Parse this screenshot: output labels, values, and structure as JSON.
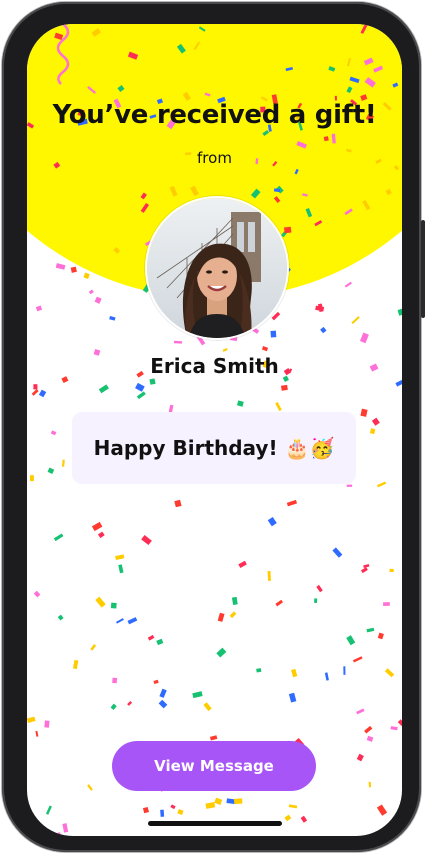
{
  "gift": {
    "title": "You’ve received a gift!",
    "from_label": "from",
    "sender_name": "Erica Smith",
    "message": "Happy Birthday! 🎂🥳",
    "button_label": "View Message"
  },
  "colors": {
    "header_yellow": "#fff700",
    "button_purple": "#a855f7",
    "card_background": "#f6f2ff",
    "confetti": [
      "#ff2d55",
      "#2f6bff",
      "#16c172",
      "#ffcc00",
      "#ff6fd8",
      "#ff3b30"
    ]
  },
  "icons": {
    "avatar": "sender-photo"
  }
}
